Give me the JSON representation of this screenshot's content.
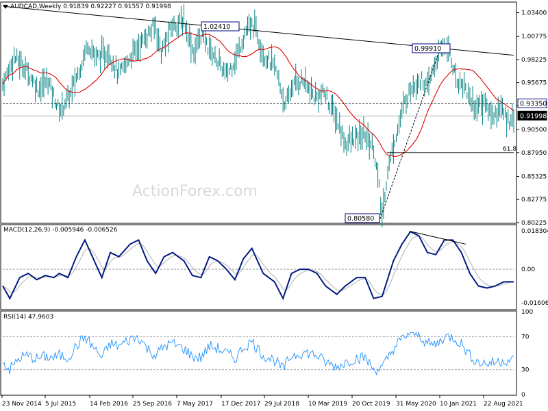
{
  "watermark": "ActionForex.com",
  "colors": {
    "price": "#008080",
    "ma": "#e00000",
    "macd": "#001a80",
    "signal": "#b0b0b0",
    "rsi": "#1e90ff",
    "trend": "#000000",
    "frame": "#000000"
  },
  "price_panel": {
    "header_symbol": "AUDCAD,Weekly",
    "header_ohlc": "0.91839 0.92227 0.91557 0.91998",
    "y_ticks": [
      "1.03400",
      "1.00775",
      "0.98225",
      "0.95675",
      "0.93125",
      "0.90500",
      "0.87950",
      "0.85325",
      "0.82775",
      "0.80225"
    ],
    "current_price": "0.91998",
    "level_label": "0.93350",
    "fib_label": "61.8",
    "annotations": {
      "high_1": "1.02410",
      "high_2": "0.99910",
      "low": "0.80580"
    }
  },
  "macd_panel": {
    "header": "MACD(12,26,9) -0.005946 -0.006526",
    "y_ticks": [
      "0.018304",
      "0.00",
      "-0.016064"
    ]
  },
  "rsi_panel": {
    "header": "RSI(14) 47.9603",
    "y_ticks": [
      "100",
      "70",
      "30",
      "0"
    ]
  },
  "x_ticks": [
    "23 Nov 2014",
    "5 Jul 2015",
    "14 Feb 2016",
    "25 Sep 2016",
    "7 May 2017",
    "17 Dec 2017",
    "29 Jul 2018",
    "10 Mar 2019",
    "20 Oct 2019",
    "31 May 2020",
    "10 Jan 2021",
    "22 Aug 2021"
  ],
  "chart_data": [
    {
      "type": "ohlc",
      "title": "AUDCAD,Weekly",
      "ylim": [
        0.8022,
        1.045
      ],
      "series": [
        {
          "name": "price",
          "x": [
            "23 Nov 2014",
            "5 Jul 2015",
            "14 Feb 2016",
            "25 Sep 2016",
            "7 May 2017",
            "17 Dec 2017",
            "29 Jul 2018",
            "10 Mar 2019",
            "20 Oct 2019",
            "31 May 2020",
            "10 Jan 2021",
            "22 Aug 2021"
          ],
          "values": [
            0.97,
            0.94,
            0.995,
            1.025,
            1.01,
            0.985,
            0.935,
            0.94,
            0.89,
            0.96,
            0.985,
            0.925
          ]
        }
      ],
      "annotations": [
        {
          "label": "1.02410"
        },
        {
          "label": "0.99910"
        },
        {
          "label": "0.80580"
        },
        {
          "label": "0.93350"
        },
        {
          "label": "61.8"
        }
      ]
    },
    {
      "type": "line",
      "title": "MACD(12,26,9) -0.005946 -0.006526",
      "ylim": [
        -0.019,
        0.021
      ],
      "series": [
        {
          "name": "MACD",
          "x": [
            "23 Nov 2014",
            "5 Jul 2015",
            "14 Feb 2016",
            "25 Sep 2016",
            "7 May 2017",
            "17 Dec 2017",
            "29 Jul 2018",
            "10 Mar 2019",
            "20 Oct 2019",
            "31 May 2020",
            "10 Jan 2021",
            "22 Aug 2021"
          ],
          "values": [
            -0.01,
            -0.003,
            0.008,
            0.012,
            0.002,
            0.004,
            -0.01,
            -0.002,
            -0.014,
            0.017,
            0.012,
            -0.006
          ]
        }
      ]
    },
    {
      "type": "line",
      "title": "RSI(14) 47.9603",
      "ylim": [
        0,
        100
      ],
      "series": [
        {
          "name": "RSI",
          "x": [
            "23 Nov 2014",
            "5 Jul 2015",
            "14 Feb 2016",
            "25 Sep 2016",
            "7 May 2017",
            "17 Dec 2017",
            "29 Jul 2018",
            "10 Mar 2019",
            "20 Oct 2019",
            "31 May 2020",
            "10 Jan 2021",
            "22 Aug 2021"
          ],
          "values": [
            42,
            48,
            55,
            60,
            50,
            55,
            35,
            45,
            30,
            65,
            60,
            48
          ]
        }
      ]
    }
  ]
}
